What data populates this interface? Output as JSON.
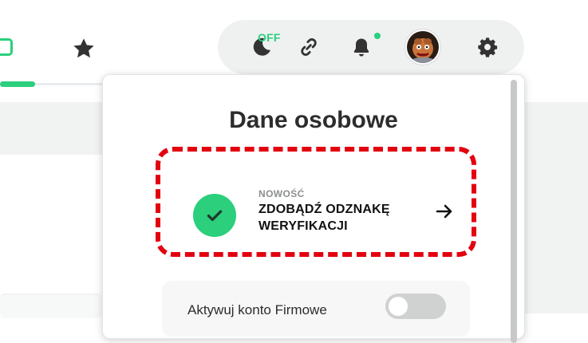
{
  "topbar": {
    "dark_mode_status": "OFF",
    "icons": [
      "moon-icon",
      "link-icon",
      "bell-icon",
      "avatar",
      "gear-icon"
    ],
    "notification_dot": true
  },
  "dropdown": {
    "title": "Dane osobowe",
    "verification": {
      "badge": "NOWOŚĆ",
      "title": "ZDOBĄDŹ ODZNAKĘ WERYFIKACJI"
    },
    "business_toggle": {
      "label": "Aktywuj konto Firmowe",
      "enabled": false
    }
  },
  "colors": {
    "accent": "#2bcf7c",
    "highlight_dashed": "#e3000f",
    "pill_bg": "#eff1f0"
  }
}
